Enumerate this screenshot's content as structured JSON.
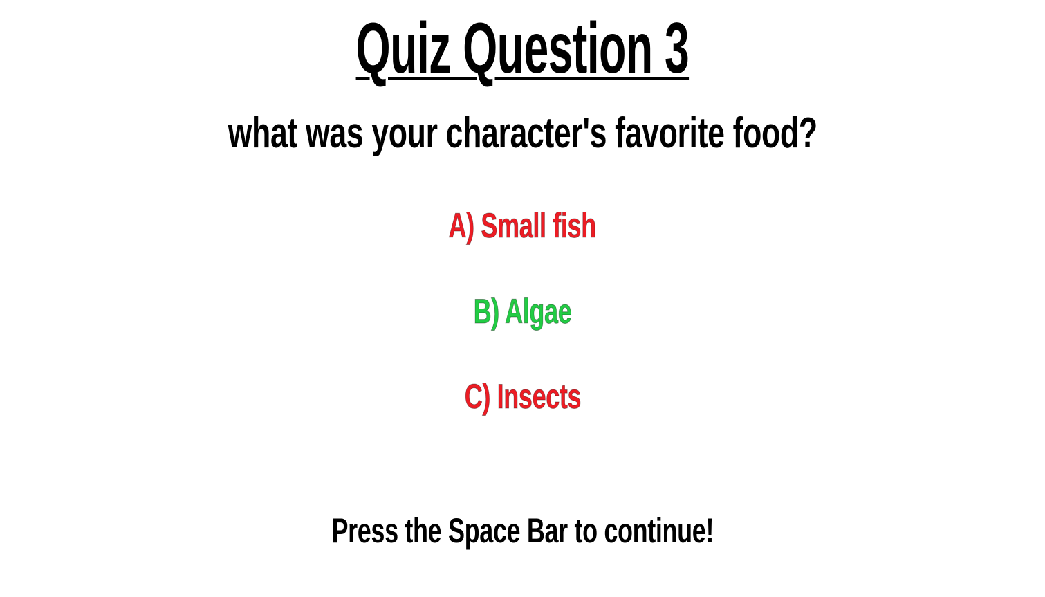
{
  "quiz": {
    "title": "Quiz Question 3",
    "question": "what was your character's favorite food?",
    "options": [
      {
        "label": "A) Small fish",
        "color": "#ed1c24",
        "status": "incorrect"
      },
      {
        "label": "B) Algae",
        "color": "#22cc44",
        "status": "correct"
      },
      {
        "label": "C) Insects",
        "color": "#ed1c24",
        "status": "incorrect"
      }
    ],
    "prompt": "Press the Space Bar to continue!"
  },
  "colors": {
    "background": "#ffffff",
    "text": "#000000",
    "incorrect": "#ed1c24",
    "correct": "#22cc44"
  }
}
